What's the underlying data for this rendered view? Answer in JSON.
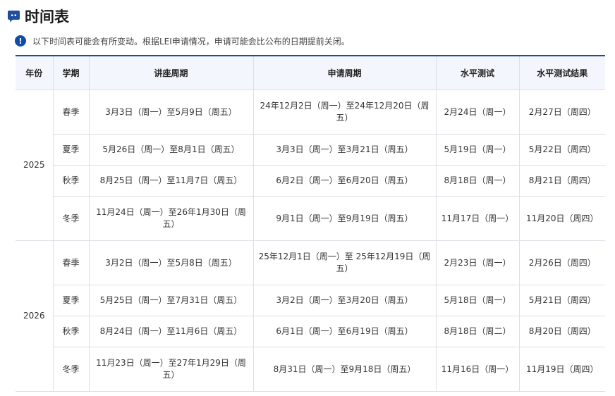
{
  "title": "时间表",
  "notice": "以下时间表可能会有所变动。根据LEI申请情况，申请可能会比公布的日期提前关闭。",
  "notice_icon": "!",
  "colors": {
    "accent": "#1f4f9c",
    "header_bg": "#f3f7fd",
    "border": "#dcdfe5"
  },
  "columns": [
    "年份",
    "学期",
    "讲座周期",
    "申请周期",
    "水平测试",
    "水平测试结果"
  ],
  "years": [
    {
      "year": "2025",
      "rows": [
        {
          "term": "春季",
          "lecture": "3月3日（周一）至5月9日（周五）",
          "application": "24年12月2日（周一）至24年12月20日（周五）",
          "test": "2月24日（周一）",
          "result": "2月27日（周四）"
        },
        {
          "term": "夏季",
          "lecture": "5月26日（周一）至8月1日（周五）",
          "application": "3月3日（周一）至3月21日（周五）",
          "test": "5月19日（周一）",
          "result": "5月22日（周四）"
        },
        {
          "term": "秋季",
          "lecture": "8月25日（周一）至11月7日（周五）",
          "application": "6月2日（周一）至6月20日（周五）",
          "test": "8月18日（周一）",
          "result": "8月21日（周四）"
        },
        {
          "term": "冬季",
          "lecture": "11月24日（周一）至26年1月30日（周五）",
          "application": "9月1日（周一）至9月19日（周五）",
          "test": "11月17日（周一）",
          "result": "11月20日（周四）"
        }
      ]
    },
    {
      "year": "2026",
      "rows": [
        {
          "term": "春季",
          "lecture": "3月2日（周一）至5月8日（周五）",
          "application": "25年12月1日（周一）至 25年12月19日（周五）",
          "test": "2月23日（周一）",
          "result": "2月26日（周四）"
        },
        {
          "term": "夏季",
          "lecture": "5月25日（周一）至7月31日（周五）",
          "application": "3月2日（周一）至3月20日（周五）",
          "test": "5月18日（周一）",
          "result": "5月21日（周四）"
        },
        {
          "term": "秋季",
          "lecture": "8月24日（周一）至11月6日（周五）",
          "application": "6月1日（周一）至6月19日（周五）",
          "test": "8月18日（周二）",
          "result": "8月20日（周四）"
        },
        {
          "term": "冬季",
          "lecture": "11月23日（周一）至27年1月29日（周五）",
          "application": "8月31日（周一）至9月18日（周五）",
          "test": "11月16日（周一）",
          "result": "11月19日（周四）"
        }
      ]
    }
  ]
}
